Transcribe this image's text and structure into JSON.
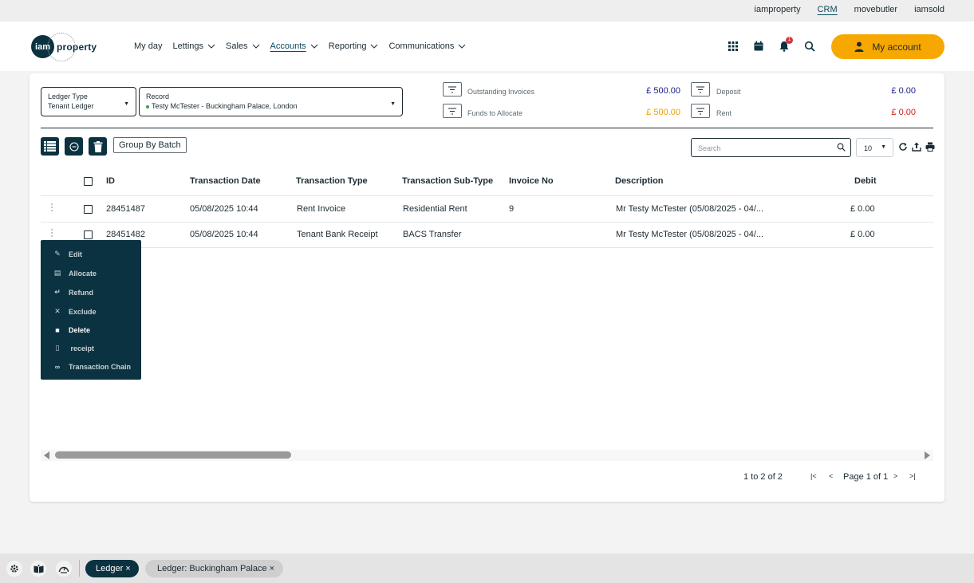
{
  "top_links": [
    "iamproperty",
    "CRM",
    "movebutler",
    "iamsold"
  ],
  "logo": {
    "badge": "iam",
    "word": "property"
  },
  "nav": [
    {
      "label": "My day",
      "chevron": false
    },
    {
      "label": "Lettings",
      "chevron": true
    },
    {
      "label": "Sales",
      "chevron": true
    },
    {
      "label": "Accounts",
      "chevron": true
    },
    {
      "label": "Reporting",
      "chevron": true
    },
    {
      "label": "Communications",
      "chevron": true
    }
  ],
  "notification_count": "1",
  "my_account_label": "My account",
  "filters": {
    "ledger_type_label": "Ledger Type",
    "ledger_type_value": "Tenant Ledger",
    "record_label": "Record",
    "record_value": "Testy McTester - Buckingham Palace, London"
  },
  "summary": {
    "outstanding_label": "Outstanding Invoices",
    "outstanding_value": "£ 500.00",
    "funds_label": "Funds to Allocate",
    "funds_value": "£ 500.00",
    "deposit_label": "Deposit",
    "deposit_value": "£ 0.00",
    "rent_label": "Rent",
    "rent_value": "£ 0.00"
  },
  "colors": {
    "outstanding": "#1a1a8c",
    "funds": "#f0a000",
    "deposit": "#1a1a8c",
    "rent": "#d0201a",
    "brand_dark": "#0b3240",
    "accent": "#f7a800"
  },
  "toolbar": {
    "group_by_batch": "Group By Batch",
    "search_placeholder": "Search",
    "page_size": "10"
  },
  "table": {
    "headers": [
      "ID",
      "Transaction Date",
      "Transaction Type",
      "Transaction Sub-Type",
      "Invoice No",
      "Description",
      "Debit"
    ],
    "rows": [
      {
        "id": "28451487",
        "date": "05/08/2025 10:44",
        "type": "Rent Invoice",
        "subtype": "Residential Rent",
        "invoice": "9",
        "description": "Mr Testy McTester (05/08/2025 - 04/...",
        "debit": "£ 0.00"
      },
      {
        "id": "28451482",
        "date": "05/08/2025 10:44",
        "type": "Tenant Bank Receipt",
        "subtype": "BACS Transfer",
        "invoice": "",
        "description": "Mr Testy McTester (05/08/2025 - 04/...",
        "debit": "£ 0.00"
      }
    ]
  },
  "context_menu": [
    {
      "label": "Edit",
      "icon": "pencil-icon"
    },
    {
      "label": "Allocate",
      "icon": "clipboard-icon"
    },
    {
      "label": "Refund",
      "icon": "return-arrow-icon"
    },
    {
      "label": "Exclude",
      "icon": "x-icon"
    },
    {
      "label": "Delete",
      "icon": "trash-icon"
    },
    {
      "label": " receipt",
      "icon": "document-icon"
    },
    {
      "label": "Transaction Chain",
      "icon": "link-icon"
    }
  ],
  "pager": {
    "range": "1 to 2 of 2",
    "page": "Page 1 of 1"
  },
  "bottom_tabs": {
    "ledger": "Ledger ×",
    "ledger_record": "Ledger: Buckingham Palace ×"
  }
}
